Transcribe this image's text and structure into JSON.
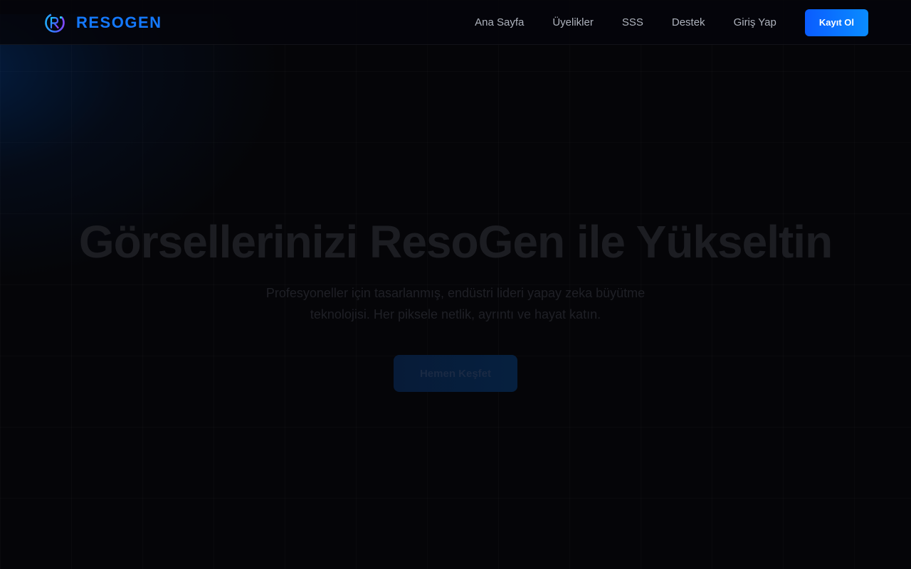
{
  "brand": {
    "name": "RESOGEN",
    "color": "#1479ff"
  },
  "nav": {
    "items": [
      {
        "label": "Ana Sayfa"
      },
      {
        "label": "Üyelikler"
      },
      {
        "label": "SSS"
      },
      {
        "label": "Destek"
      },
      {
        "label": "Giriş Yap"
      }
    ],
    "signup_label": "Kayıt Ol"
  },
  "hero": {
    "title": "Görsellerinizi ResoGen ile Yükseltin",
    "subtitle": "Profesyoneller için tasarlanmış, endüstri lideri yapay zeka büyütme teknolojisi. Her piksele netlik, ayrıntı ve hayat katın.",
    "cta_label": "Hemen Keşfet"
  },
  "colors": {
    "background": "#050508",
    "accent": "#0a6cff"
  }
}
